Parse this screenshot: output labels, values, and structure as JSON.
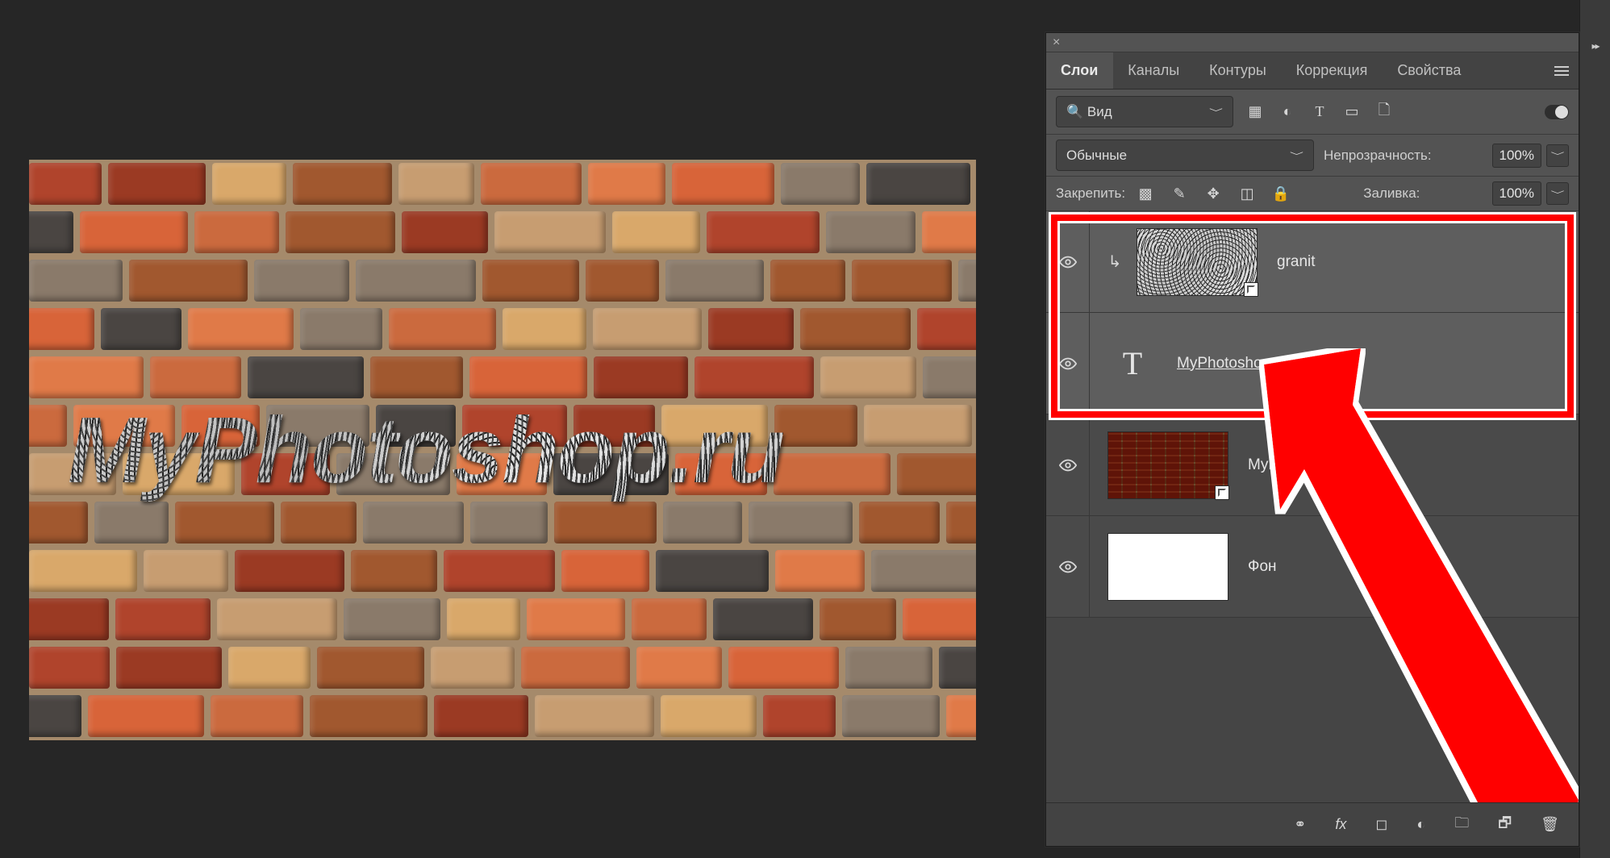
{
  "canvas": {
    "text_overlay": "MyPhotoshop.ru"
  },
  "panel": {
    "tabs": [
      "Слои",
      "Каналы",
      "Контуры",
      "Коррекция",
      "Свойства"
    ],
    "active_tab_index": 0,
    "filter": {
      "search_placeholder": "Вид",
      "icons": [
        "image-filter-icon",
        "adjustment-filter-icon",
        "type-filter-icon",
        "shape-filter-icon",
        "smart-filter-icon"
      ]
    },
    "blend": {
      "mode": "Обычные",
      "opacity_label": "Непрозрачность:",
      "opacity_value": "100%"
    },
    "lock": {
      "label": "Закрепить:",
      "fill_label": "Заливка:",
      "fill_value": "100%"
    },
    "layers": [
      {
        "name": "granit",
        "kind": "smart",
        "clipped": true,
        "selected": true,
        "thumb": "granite"
      },
      {
        "name": "MyPhotoshop.ru",
        "kind": "type",
        "clipped": false,
        "selected": true,
        "thumb": "type"
      },
      {
        "name": "MyPhotoshop",
        "kind": "smart",
        "clipped": false,
        "selected": false,
        "thumb": "brick"
      },
      {
        "name": "Фон",
        "kind": "pixel",
        "clipped": false,
        "selected": false,
        "thumb": "white"
      }
    ],
    "footer_icons": [
      "link-icon",
      "fx-icon",
      "mask-icon",
      "adjustment-icon",
      "group-icon",
      "new-layer-icon",
      "trash-icon"
    ]
  }
}
